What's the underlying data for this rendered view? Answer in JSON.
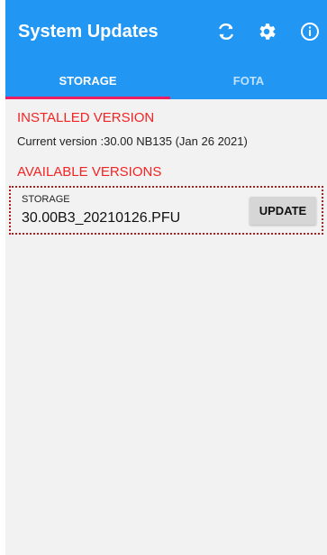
{
  "app": {
    "title": "System Updates",
    "accent_color": "#2196f3",
    "indicator_color": "#e91e63",
    "section_color": "#f22424"
  },
  "actions": [
    {
      "icon": "refresh-icon"
    },
    {
      "icon": "gear-icon"
    },
    {
      "icon": "info-icon"
    }
  ],
  "tabs": [
    {
      "label": "STORAGE",
      "selected": true
    },
    {
      "label": "FOTA",
      "selected": false
    }
  ],
  "installed": {
    "title": "INSTALLED VERSION",
    "current_version": "Current version :30.00 NB135 (Jan 26 2021)"
  },
  "available": {
    "title": "AVAILABLE VERSIONS",
    "items": [
      {
        "source": "STORAGE",
        "file_name": "30.00B3_20210126.PFU",
        "button_label": "UPDATE"
      }
    ]
  }
}
